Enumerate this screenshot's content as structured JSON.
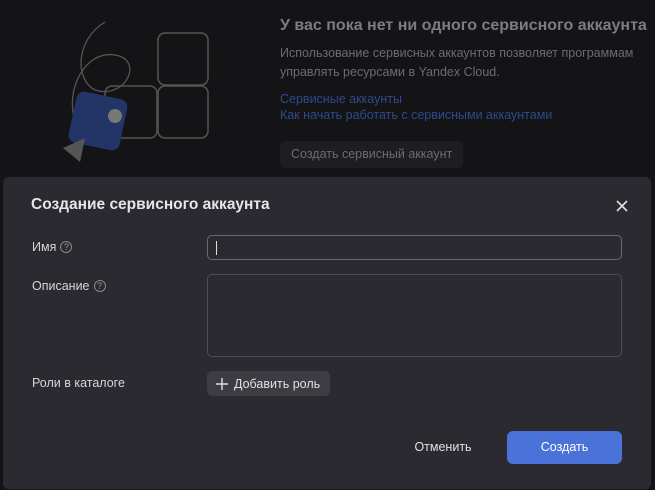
{
  "empty_state": {
    "title": "У вас пока нет ни одного сервисного аккаунта",
    "description": "Использование сервисных аккаунтов позволяет программам управлять ресурсами в Yandex Cloud.",
    "links": [
      "Сервисные аккаунты",
      "Как начать работать с сервисными аккаунтами"
    ],
    "create_button": "Создать сервисный аккаунт"
  },
  "dialog": {
    "title": "Создание сервисного аккаунта",
    "fields": {
      "name_label": "Имя",
      "name_value": "",
      "description_label": "Описание",
      "description_value": "",
      "roles_label": "Роли в каталоге",
      "add_role_button": "Добавить роль"
    },
    "help_glyph": "?",
    "cancel_button": "Отменить",
    "create_button": "Создать"
  },
  "colors": {
    "accent": "#4b72d9",
    "dialog_bg": "#2a2a30",
    "overlay_bg": "#141417"
  }
}
